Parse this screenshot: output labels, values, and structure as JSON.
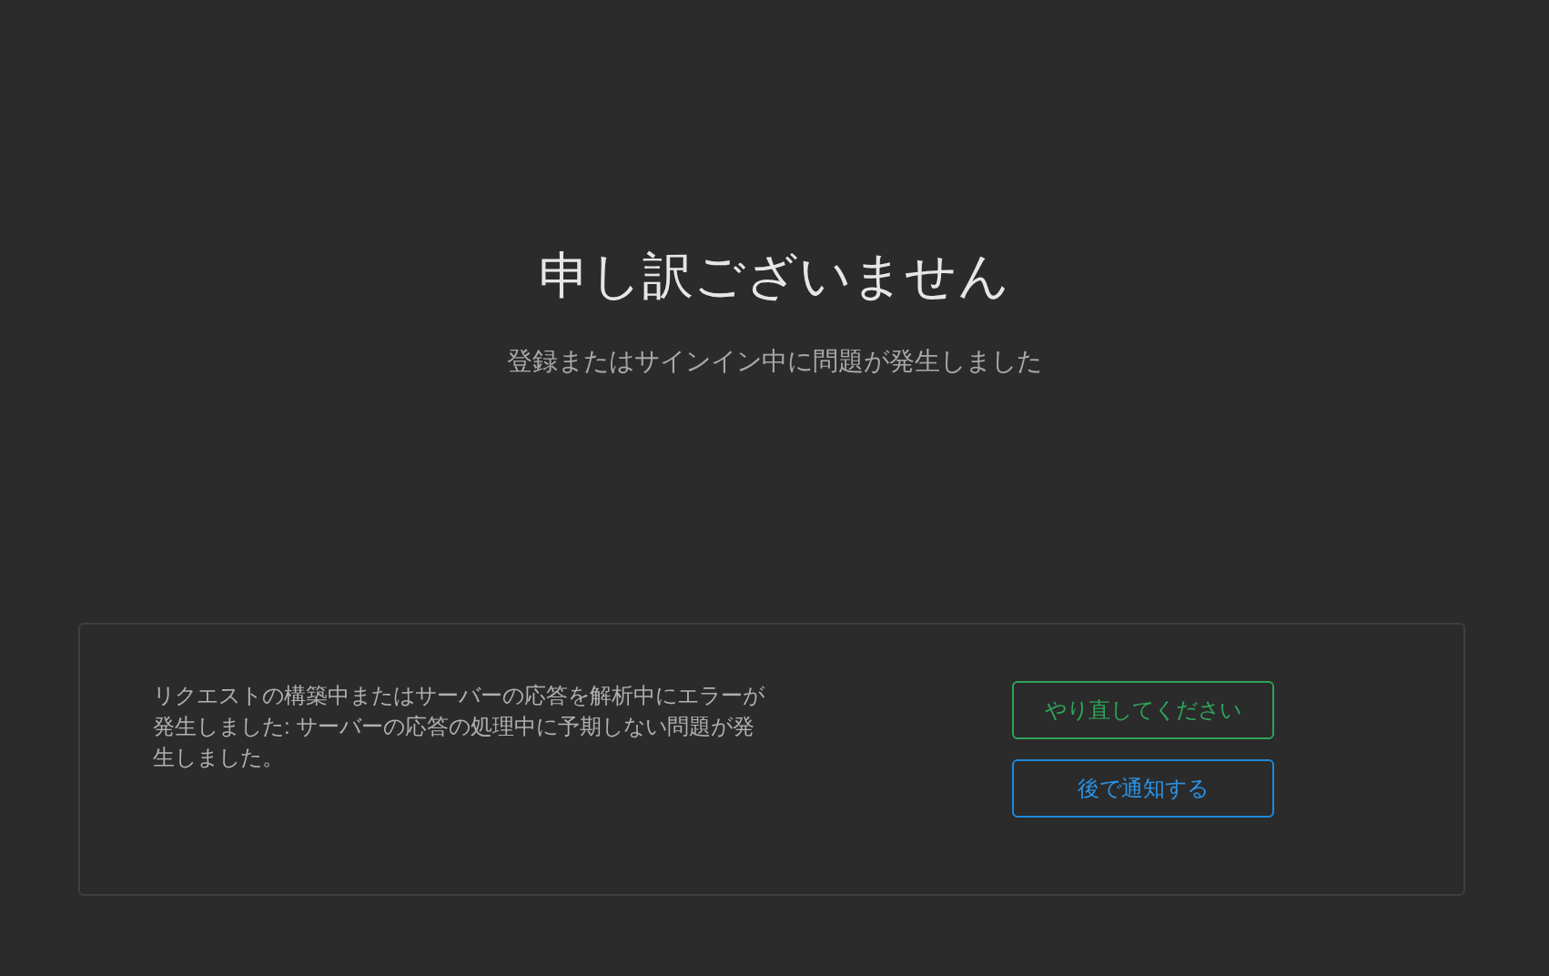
{
  "title": "申し訳ございません",
  "subtitle": "登録またはサインイン中に問題が発生しました",
  "error_panel": {
    "message": "リクエストの構築中またはサーバーの応答を解析中にエラーが発生しました: サーバーの応答の処理中に予期しない問題が発生しました。",
    "buttons": [
      {
        "label": "やり直してください",
        "kind": "retry"
      },
      {
        "label": "後で通知する",
        "kind": "later"
      }
    ]
  }
}
